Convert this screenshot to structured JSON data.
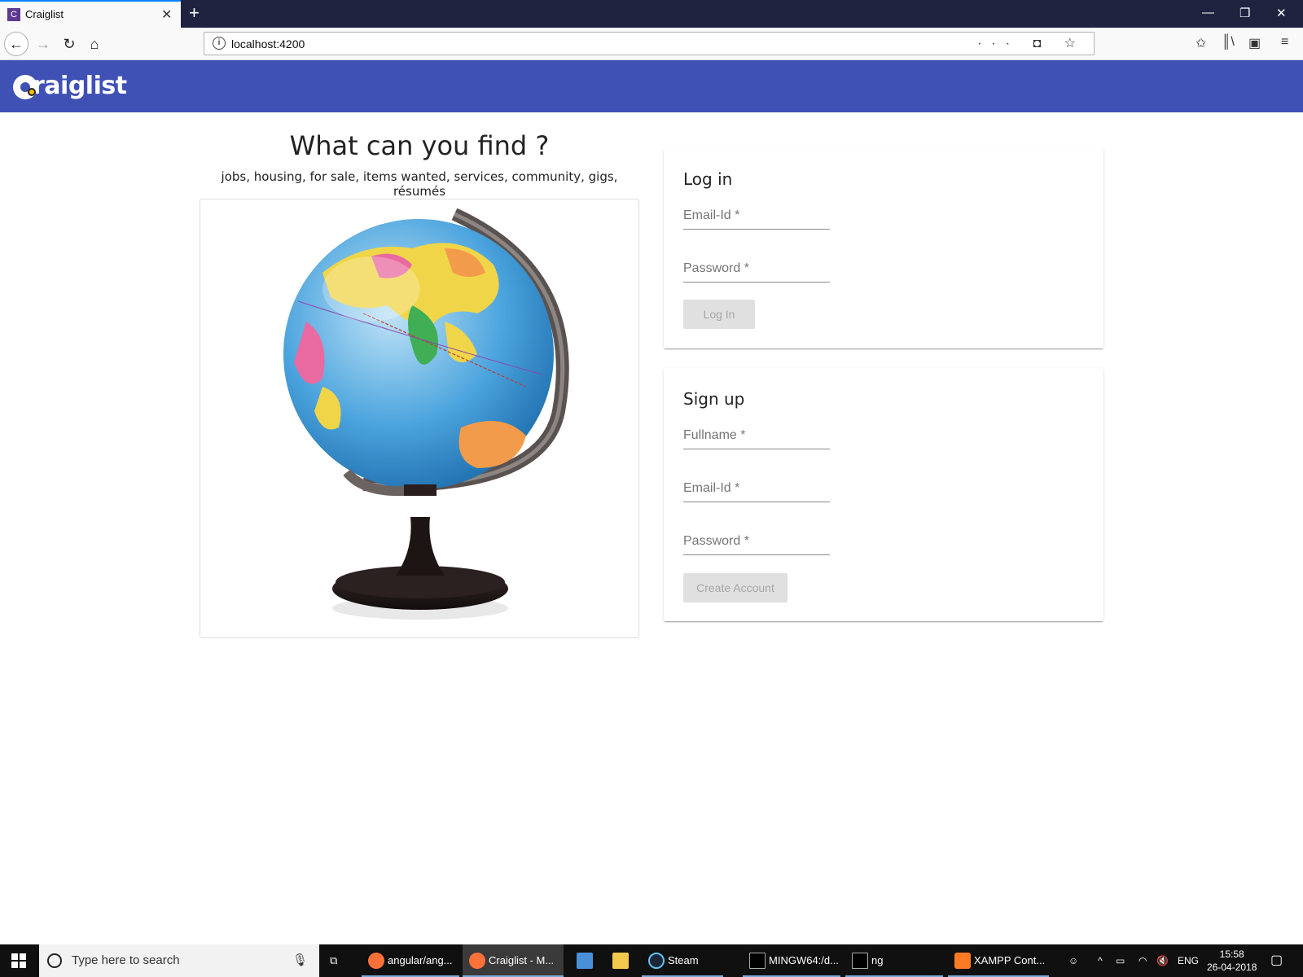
{
  "browser": {
    "tab_title": "Craiglist",
    "tab_favicon": "C",
    "url": "localhost:4200",
    "new_tab": "+",
    "window_controls": [
      "—",
      "❐",
      "✕"
    ]
  },
  "app": {
    "brand": "raiglist",
    "brand_color": "#3f51b5"
  },
  "hero": {
    "title": "What can you find ?",
    "subtitle": "jobs, housing, for sale, items wanted, services, community, gigs, résumés"
  },
  "login": {
    "title": "Log in",
    "email_label": "Email-Id *",
    "password_label": "Password *",
    "button": "Log In"
  },
  "signup": {
    "title": "Sign up",
    "fullname_label": "Fullname *",
    "email_label": "Email-Id *",
    "password_label": "Password *",
    "button": "Create Account"
  },
  "taskbar": {
    "search_placeholder": "Type here to search",
    "items": [
      {
        "label": "angular/ang...",
        "icon": "firefox-icon"
      },
      {
        "label": "Craiglist - M...",
        "icon": "firefox-icon"
      },
      {
        "label": "",
        "icon": "laptop-icon"
      },
      {
        "label": "",
        "icon": "folder-icon"
      },
      {
        "label": "Steam",
        "icon": "steam-icon"
      },
      {
        "label": "MINGW64:/d...",
        "icon": "terminal-icon"
      },
      {
        "label": "ng",
        "icon": "terminal-icon"
      },
      {
        "label": "XAMPP Cont...",
        "icon": "xampp-icon"
      }
    ],
    "language": "ENG",
    "time": "15:58",
    "date": "26-04-2018"
  }
}
